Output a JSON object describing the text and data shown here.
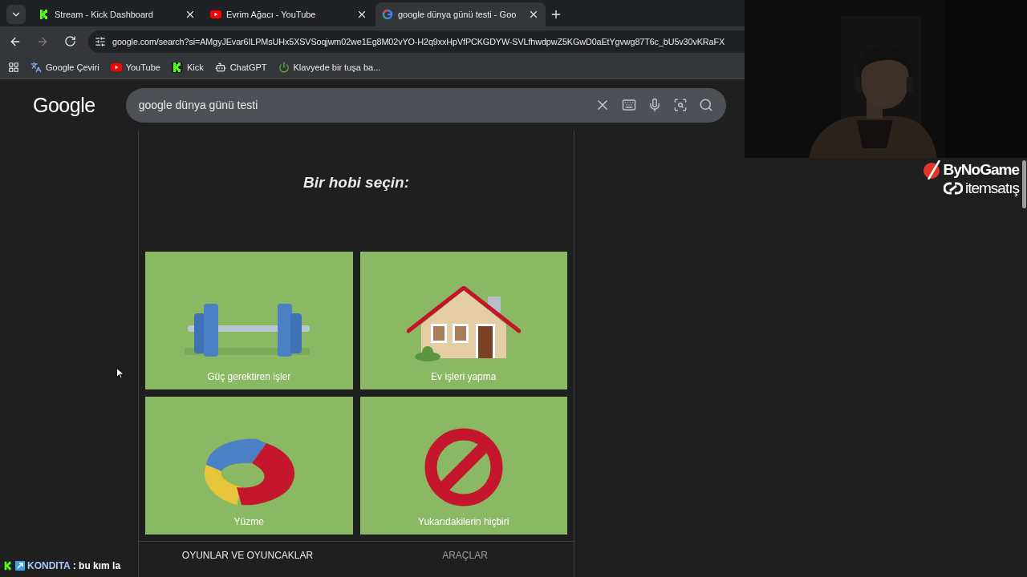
{
  "browser": {
    "tabs": [
      {
        "title": "Stream - Kick Dashboard",
        "kind": "kick",
        "selected": false
      },
      {
        "title": "Evrim Ağacı - YouTube",
        "kind": "youtube",
        "selected": false
      },
      {
        "title": "google dünya günü testi - Goo",
        "kind": "google",
        "selected": true
      }
    ],
    "url": "google.com/search?si=AMgyJEvar6ILPMsUHx5XSVSoqjwm02we1Eg8M02vYO-H2q9xxHpVfPCKGDYW-SVLfhwdpwZ5KGwD0aEtYgvwg87T6c_bU5v30vKRaFX",
    "bookmarks": [
      {
        "label": "Google Çeviri",
        "kind": "translate"
      },
      {
        "label": "YouTube",
        "kind": "youtube"
      },
      {
        "label": "Kick",
        "kind": "kick"
      },
      {
        "label": "ChatGPT",
        "kind": "chatgpt"
      },
      {
        "label": "Klavyede bir tuşa ba...",
        "kind": "power"
      }
    ]
  },
  "google": {
    "logo": "Google",
    "query": "google dünya günü testi"
  },
  "quiz": {
    "title": "Bir hobi seçin:",
    "options": [
      {
        "label": "Güç gerektiren işler",
        "kind": "dumbbell"
      },
      {
        "label": "Ev işleri yapma",
        "kind": "house"
      },
      {
        "label": "Yüzme",
        "kind": "ring"
      },
      {
        "label": "Yukarıdakilerin hiçbiri",
        "kind": "none"
      }
    ],
    "bottom_tabs": [
      {
        "label": "OYUNLAR VE OYUNCAKLAR",
        "selected": true
      },
      {
        "label": "ARAÇLAR",
        "selected": false
      }
    ]
  },
  "overlay": {
    "sponsor": {
      "line_1": "ByNoGame",
      "line_2": "itemsatış"
    },
    "chat": {
      "user": "KONDITA",
      "message": ": bu kım la"
    }
  }
}
